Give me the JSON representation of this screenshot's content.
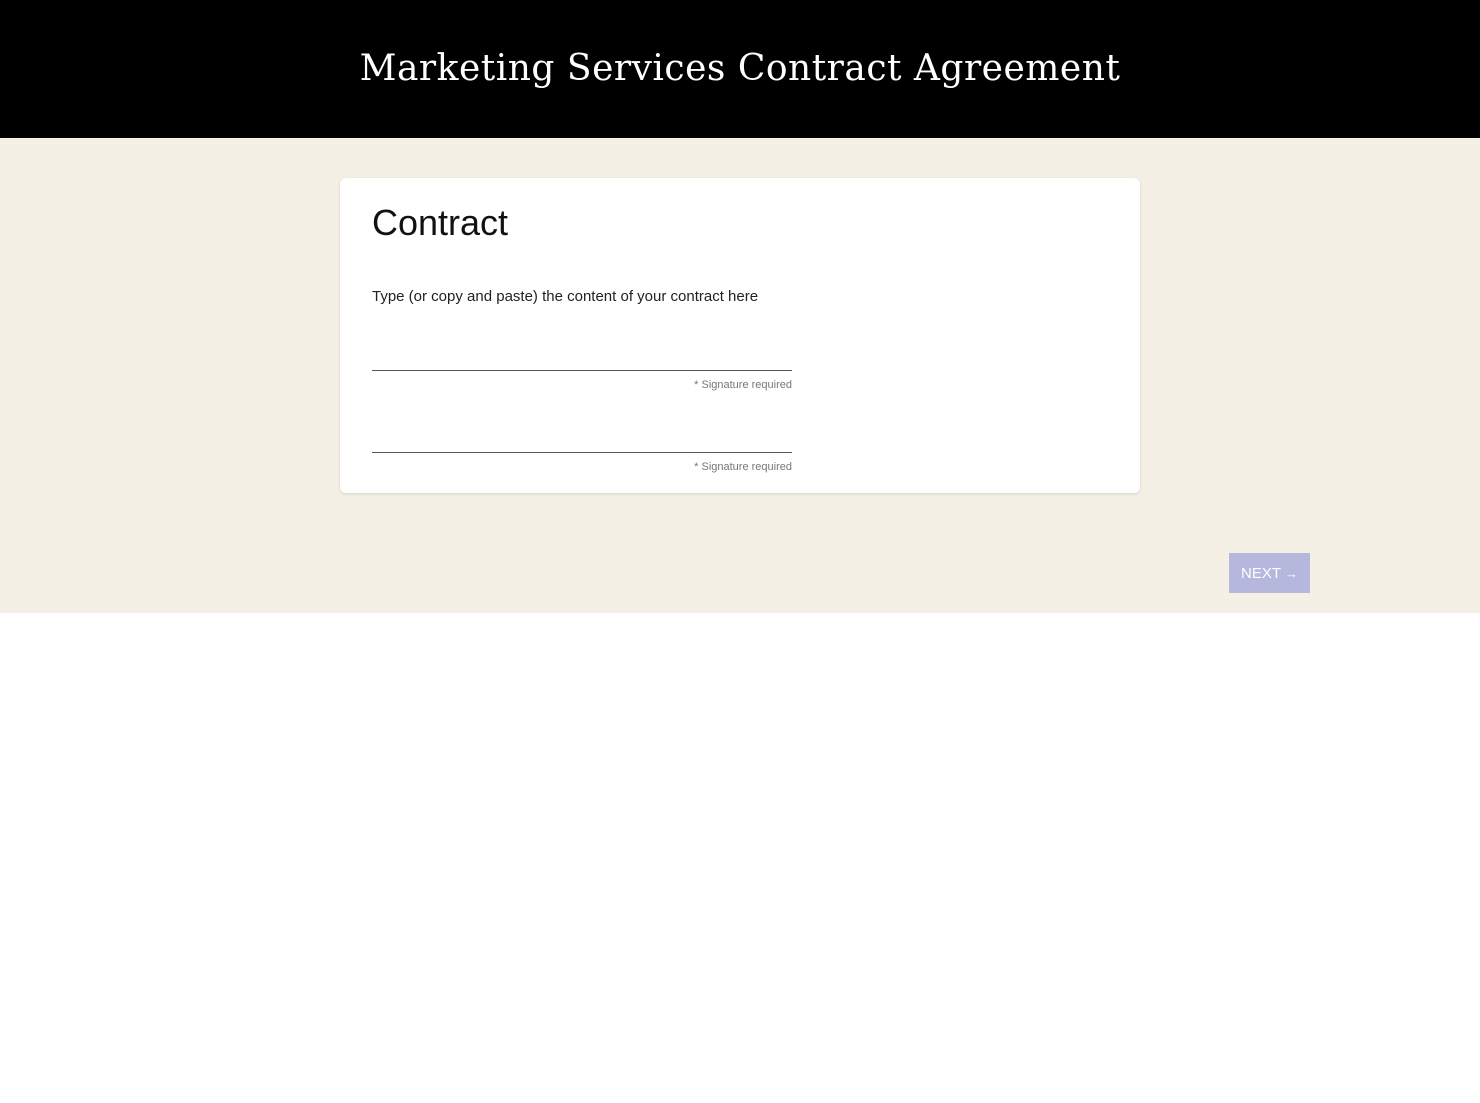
{
  "header": {
    "title": "Marketing Services Contract Agreement"
  },
  "card": {
    "title": "Contract",
    "description": "Type (or copy and paste) the content of your contract here",
    "signatures": [
      {
        "value": "",
        "note": "* Signature required"
      },
      {
        "value": "",
        "note": "* Signature required"
      }
    ]
  },
  "navigation": {
    "next_label": "NEXT",
    "next_icon": "arrow-right-icon",
    "next_arrow": "→"
  },
  "colors": {
    "header_bg": "#000000",
    "page_bg": "#f4f0e5",
    "card_bg": "#ffffff",
    "next_button_bg": "#b6b7dc"
  }
}
